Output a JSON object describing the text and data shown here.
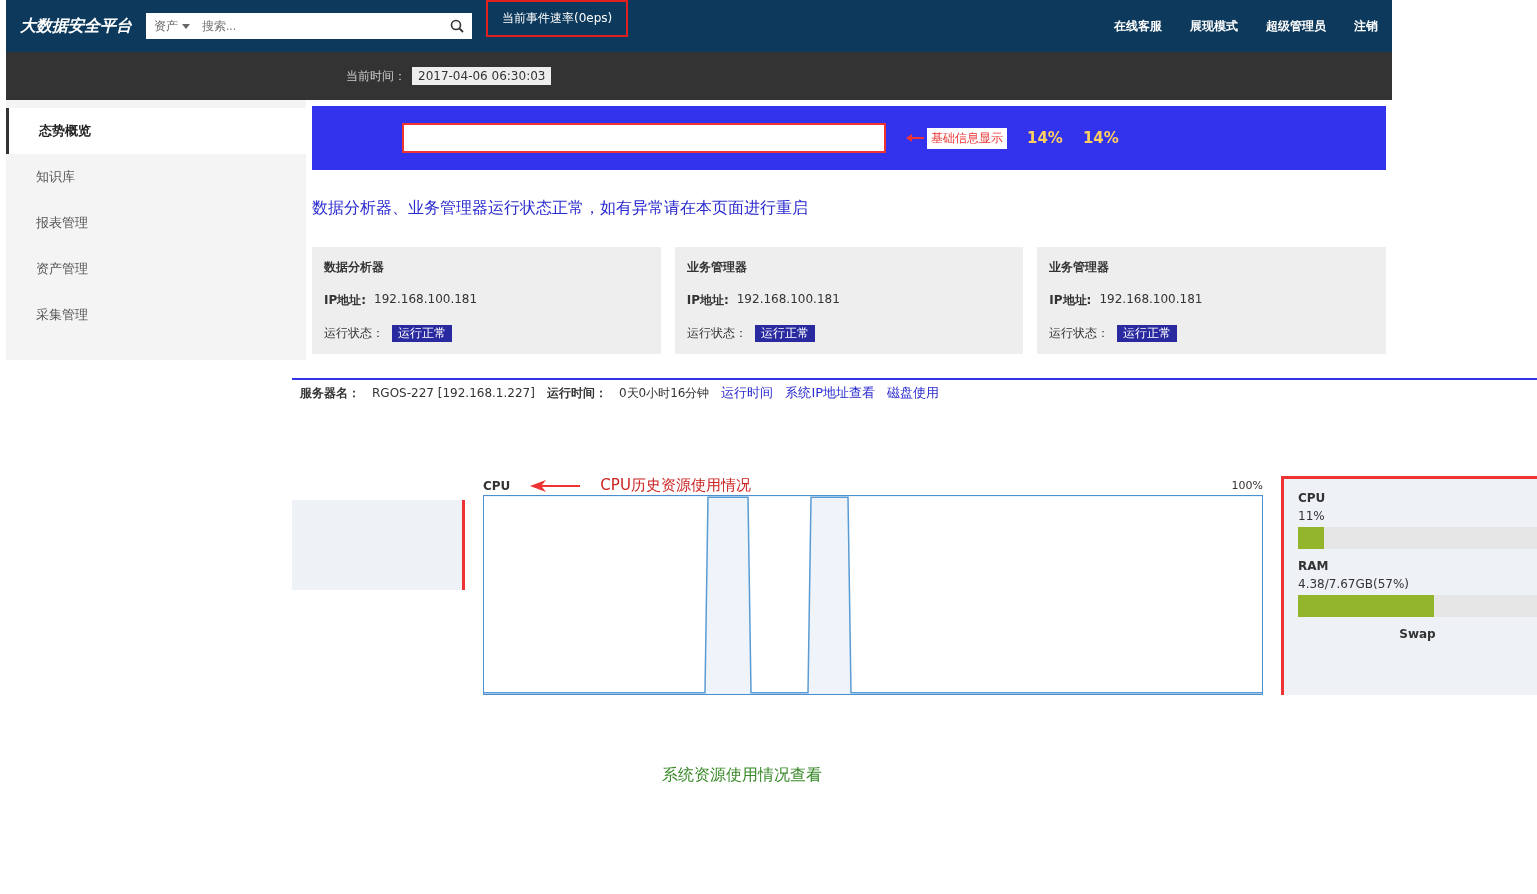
{
  "header": {
    "logo": "大数据安全平台",
    "search": {
      "scope": "资产",
      "placeholder": "搜索..."
    },
    "event_rate": "当前事件速率(0eps)",
    "nav": [
      "在线客服",
      "展现模式",
      "超级管理员",
      "注销"
    ]
  },
  "welcome": {
    "label": "当前时间：",
    "time": "2017-04-06 06:30:03"
  },
  "sidebar": {
    "items": [
      {
        "label": "态势概览",
        "selected": true
      },
      {
        "label": "知识库",
        "selected": false
      },
      {
        "label": "报表管理",
        "selected": false
      },
      {
        "label": "资产管理",
        "selected": false
      },
      {
        "label": "采集管理",
        "selected": false
      }
    ]
  },
  "banner": {
    "annotation": "基础信息显示",
    "gauges": [
      "14%",
      "14%"
    ]
  },
  "notice": "数据分析器、业务管理器运行状态正常，如有异常请在本页面进行重启",
  "devices": [
    {
      "name": "数据分析器",
      "ip_label": "IP地址:",
      "ip": "192.168.100.181",
      "status_label": "运行状态：",
      "status": "运行正常"
    },
    {
      "name": "业务管理器",
      "ip_label": "IP地址:",
      "ip": "192.168.100.181",
      "status_label": "运行状态：",
      "status": "运行正常"
    },
    {
      "name": "业务管理器",
      "ip_label": "IP地址:",
      "ip": "192.168.100.181",
      "status_label": "运行状态：",
      "status": "运行正常"
    }
  ],
  "server": {
    "name_label": "服务器名：",
    "name": "RGOS-227 [192.168.1.227]",
    "uptime_label": "运行时间：",
    "uptime": "0天0小时16分钟",
    "notes": [
      "运行时间",
      "系统IP地址查看",
      "磁盘使用"
    ]
  },
  "cpu_history": {
    "annotation": "CPU历史资源使用情况",
    "label": "CPU",
    "max": "100%"
  },
  "resources": [
    {
      "name": "CPU",
      "reading": "11%",
      "level": 0.11
    },
    {
      "name": "RAM",
      "reading": "4.38/7.67GB(57%)",
      "level": 0.57
    }
  ],
  "swap": "Swap",
  "caption": "系统资源使用情况查看"
}
